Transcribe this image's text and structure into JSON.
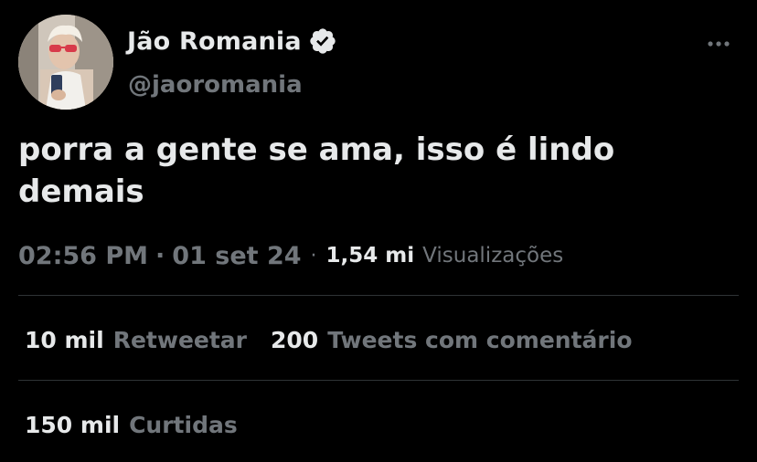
{
  "author": {
    "display_name": "Jão Romania",
    "handle": "@jaoromania",
    "verified_icon": "verified-badge-icon",
    "avatar": "profile-photo"
  },
  "tweet": {
    "text": "porra a gente se ama, isso é lindo demais"
  },
  "meta": {
    "time": "02:56 PM",
    "separator": "·",
    "date": "01 set 24",
    "views_count": "1,54 mi",
    "views_label": "Visualizações"
  },
  "stats": {
    "retweets_count": "10 mil",
    "retweets_label": "Retweetar",
    "quotes_count": "200",
    "quotes_label": "Tweets com comentário",
    "likes_count": "150 mil",
    "likes_label": "Curtidas"
  },
  "colors": {
    "background": "#000000",
    "primary_text": "#e7e9ea",
    "secondary_text": "#71767b",
    "divider": "#2f3336"
  },
  "icons": {
    "more": "more-options-icon"
  }
}
